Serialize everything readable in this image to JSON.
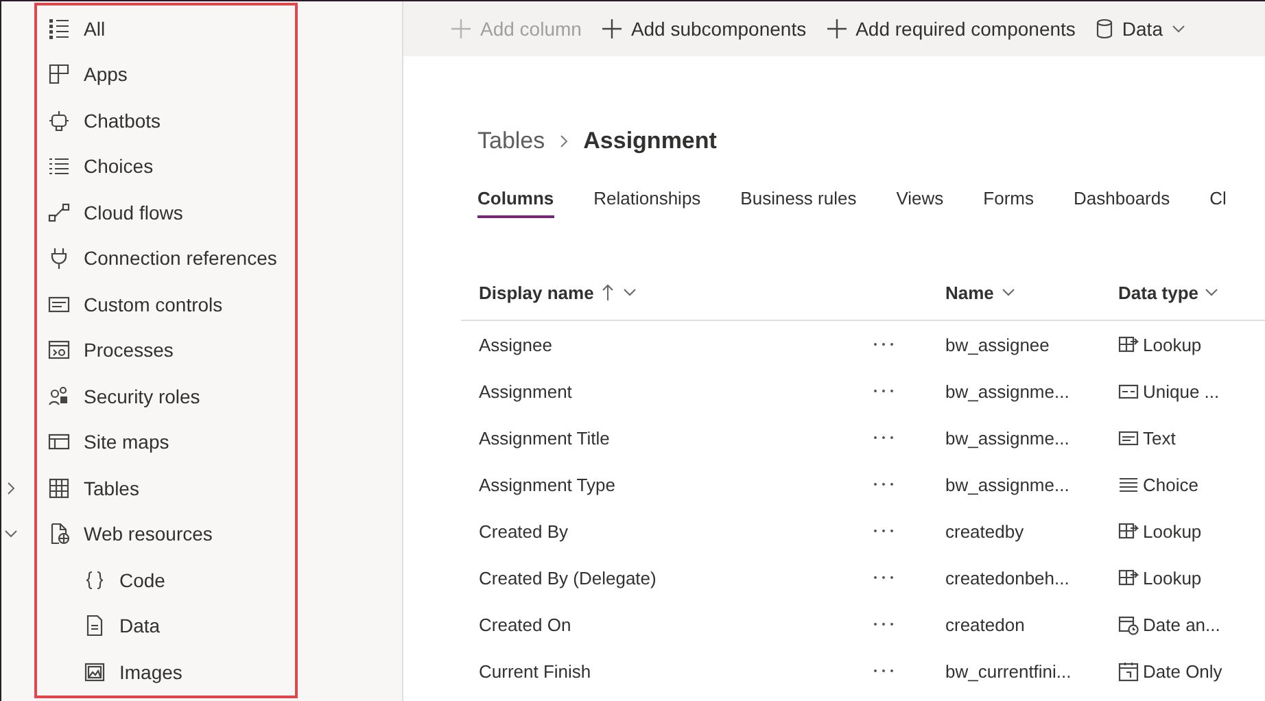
{
  "sidebar": {
    "highlighted": true,
    "items": [
      {
        "label": "All"
      },
      {
        "label": "Apps"
      },
      {
        "label": "Chatbots"
      },
      {
        "label": "Choices"
      },
      {
        "label": "Cloud flows"
      },
      {
        "label": "Connection references"
      },
      {
        "label": "Custom controls"
      },
      {
        "label": "Processes"
      },
      {
        "label": "Security roles"
      },
      {
        "label": "Site maps"
      },
      {
        "label": "Tables",
        "expanded": false
      },
      {
        "label": "Web resources",
        "expanded": true,
        "children": [
          {
            "label": "Code"
          },
          {
            "label": "Data"
          },
          {
            "label": "Images"
          }
        ]
      }
    ]
  },
  "toolbar": [
    {
      "label": "Add column",
      "kind": "add",
      "disabled": true
    },
    {
      "label": "Add subcomponents",
      "kind": "add",
      "disabled": false
    },
    {
      "label": "Add required components",
      "kind": "add",
      "disabled": false
    },
    {
      "label": "Data",
      "kind": "menu",
      "disabled": false
    }
  ],
  "breadcrumb": {
    "parent": "Tables",
    "current": "Assignment"
  },
  "tabs": [
    {
      "label": "Columns",
      "selected": true
    },
    {
      "label": "Relationships",
      "selected": false
    },
    {
      "label": "Business rules",
      "selected": false
    },
    {
      "label": "Views",
      "selected": false
    },
    {
      "label": "Forms",
      "selected": false
    },
    {
      "label": "Dashboards",
      "selected": false
    },
    {
      "label": "Cl",
      "selected": false
    }
  ],
  "table": {
    "columns": [
      {
        "label": "Display name",
        "sorted": true
      },
      {
        "label": "Name",
        "sorted": false
      },
      {
        "label": "Data type",
        "sorted": false
      }
    ],
    "rows": [
      {
        "display_name": "Assignee",
        "name": "bw_assignee",
        "data_type": "Lookup",
        "kind": "lookup"
      },
      {
        "display_name": "Assignment",
        "name": "bw_assignme...",
        "data_type": "Unique ...",
        "kind": "unique"
      },
      {
        "display_name": "Assignment Title",
        "name": "bw_assignme...",
        "data_type": "Text",
        "kind": "text"
      },
      {
        "display_name": "Assignment Type",
        "name": "bw_assignme...",
        "data_type": "Choice",
        "kind": "choice"
      },
      {
        "display_name": "Created By",
        "name": "createdby",
        "data_type": "Lookup",
        "kind": "lookup"
      },
      {
        "display_name": "Created By (Delegate)",
        "name": "createdonbeh...",
        "data_type": "Lookup",
        "kind": "lookup"
      },
      {
        "display_name": "Created On",
        "name": "createdon",
        "data_type": "Date an...",
        "kind": "datetime"
      },
      {
        "display_name": "Current Finish",
        "name": "bw_currentfini...",
        "data_type": "Date Only",
        "kind": "date"
      }
    ]
  }
}
